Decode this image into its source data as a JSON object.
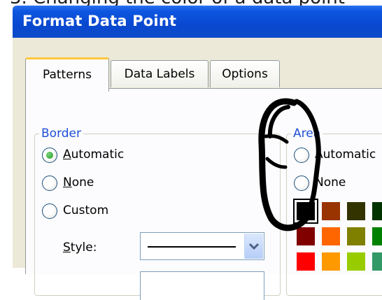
{
  "caption": "3. Changing the color of a data point",
  "window": {
    "title": "Format Data Point"
  },
  "tabs": [
    {
      "label": "Patterns",
      "active": true
    },
    {
      "label": "Data Labels",
      "active": false
    },
    {
      "label": "Options",
      "active": false
    }
  ],
  "border_group": {
    "label": "Border",
    "options": [
      {
        "label": "Automatic",
        "mnemonic": "A",
        "rest": "utomatic",
        "selected": true
      },
      {
        "label": "None",
        "mnemonic": "N",
        "rest": "one",
        "selected": false
      },
      {
        "label": "Custom",
        "selected": false
      }
    ],
    "style_label": "Style:",
    "style_mnemonic": "S",
    "style_rest": "tyle:"
  },
  "area_group": {
    "label": "Area",
    "options": [
      {
        "label": "Automatic",
        "selected": false
      },
      {
        "label": "None",
        "selected": false
      }
    ]
  },
  "palette_colors": [
    [
      "#000000",
      "#993300",
      "#333300",
      "#003300"
    ],
    [
      "#800000",
      "#ff6600",
      "#808000",
      "#008000"
    ],
    [
      "#ff0000",
      "#ff9900",
      "#99cc00",
      "#339966"
    ]
  ],
  "colors": {
    "titlebar": "#0a48d0",
    "dialog_bg": "#ece9d8",
    "panel_bg": "#fcfcfe",
    "group_label": "#1f4fd6",
    "tab_highlight": "#ffc83c"
  },
  "icons": {
    "dropdown": "chevron-down-icon",
    "annotation": "hand-drawn-circle"
  }
}
